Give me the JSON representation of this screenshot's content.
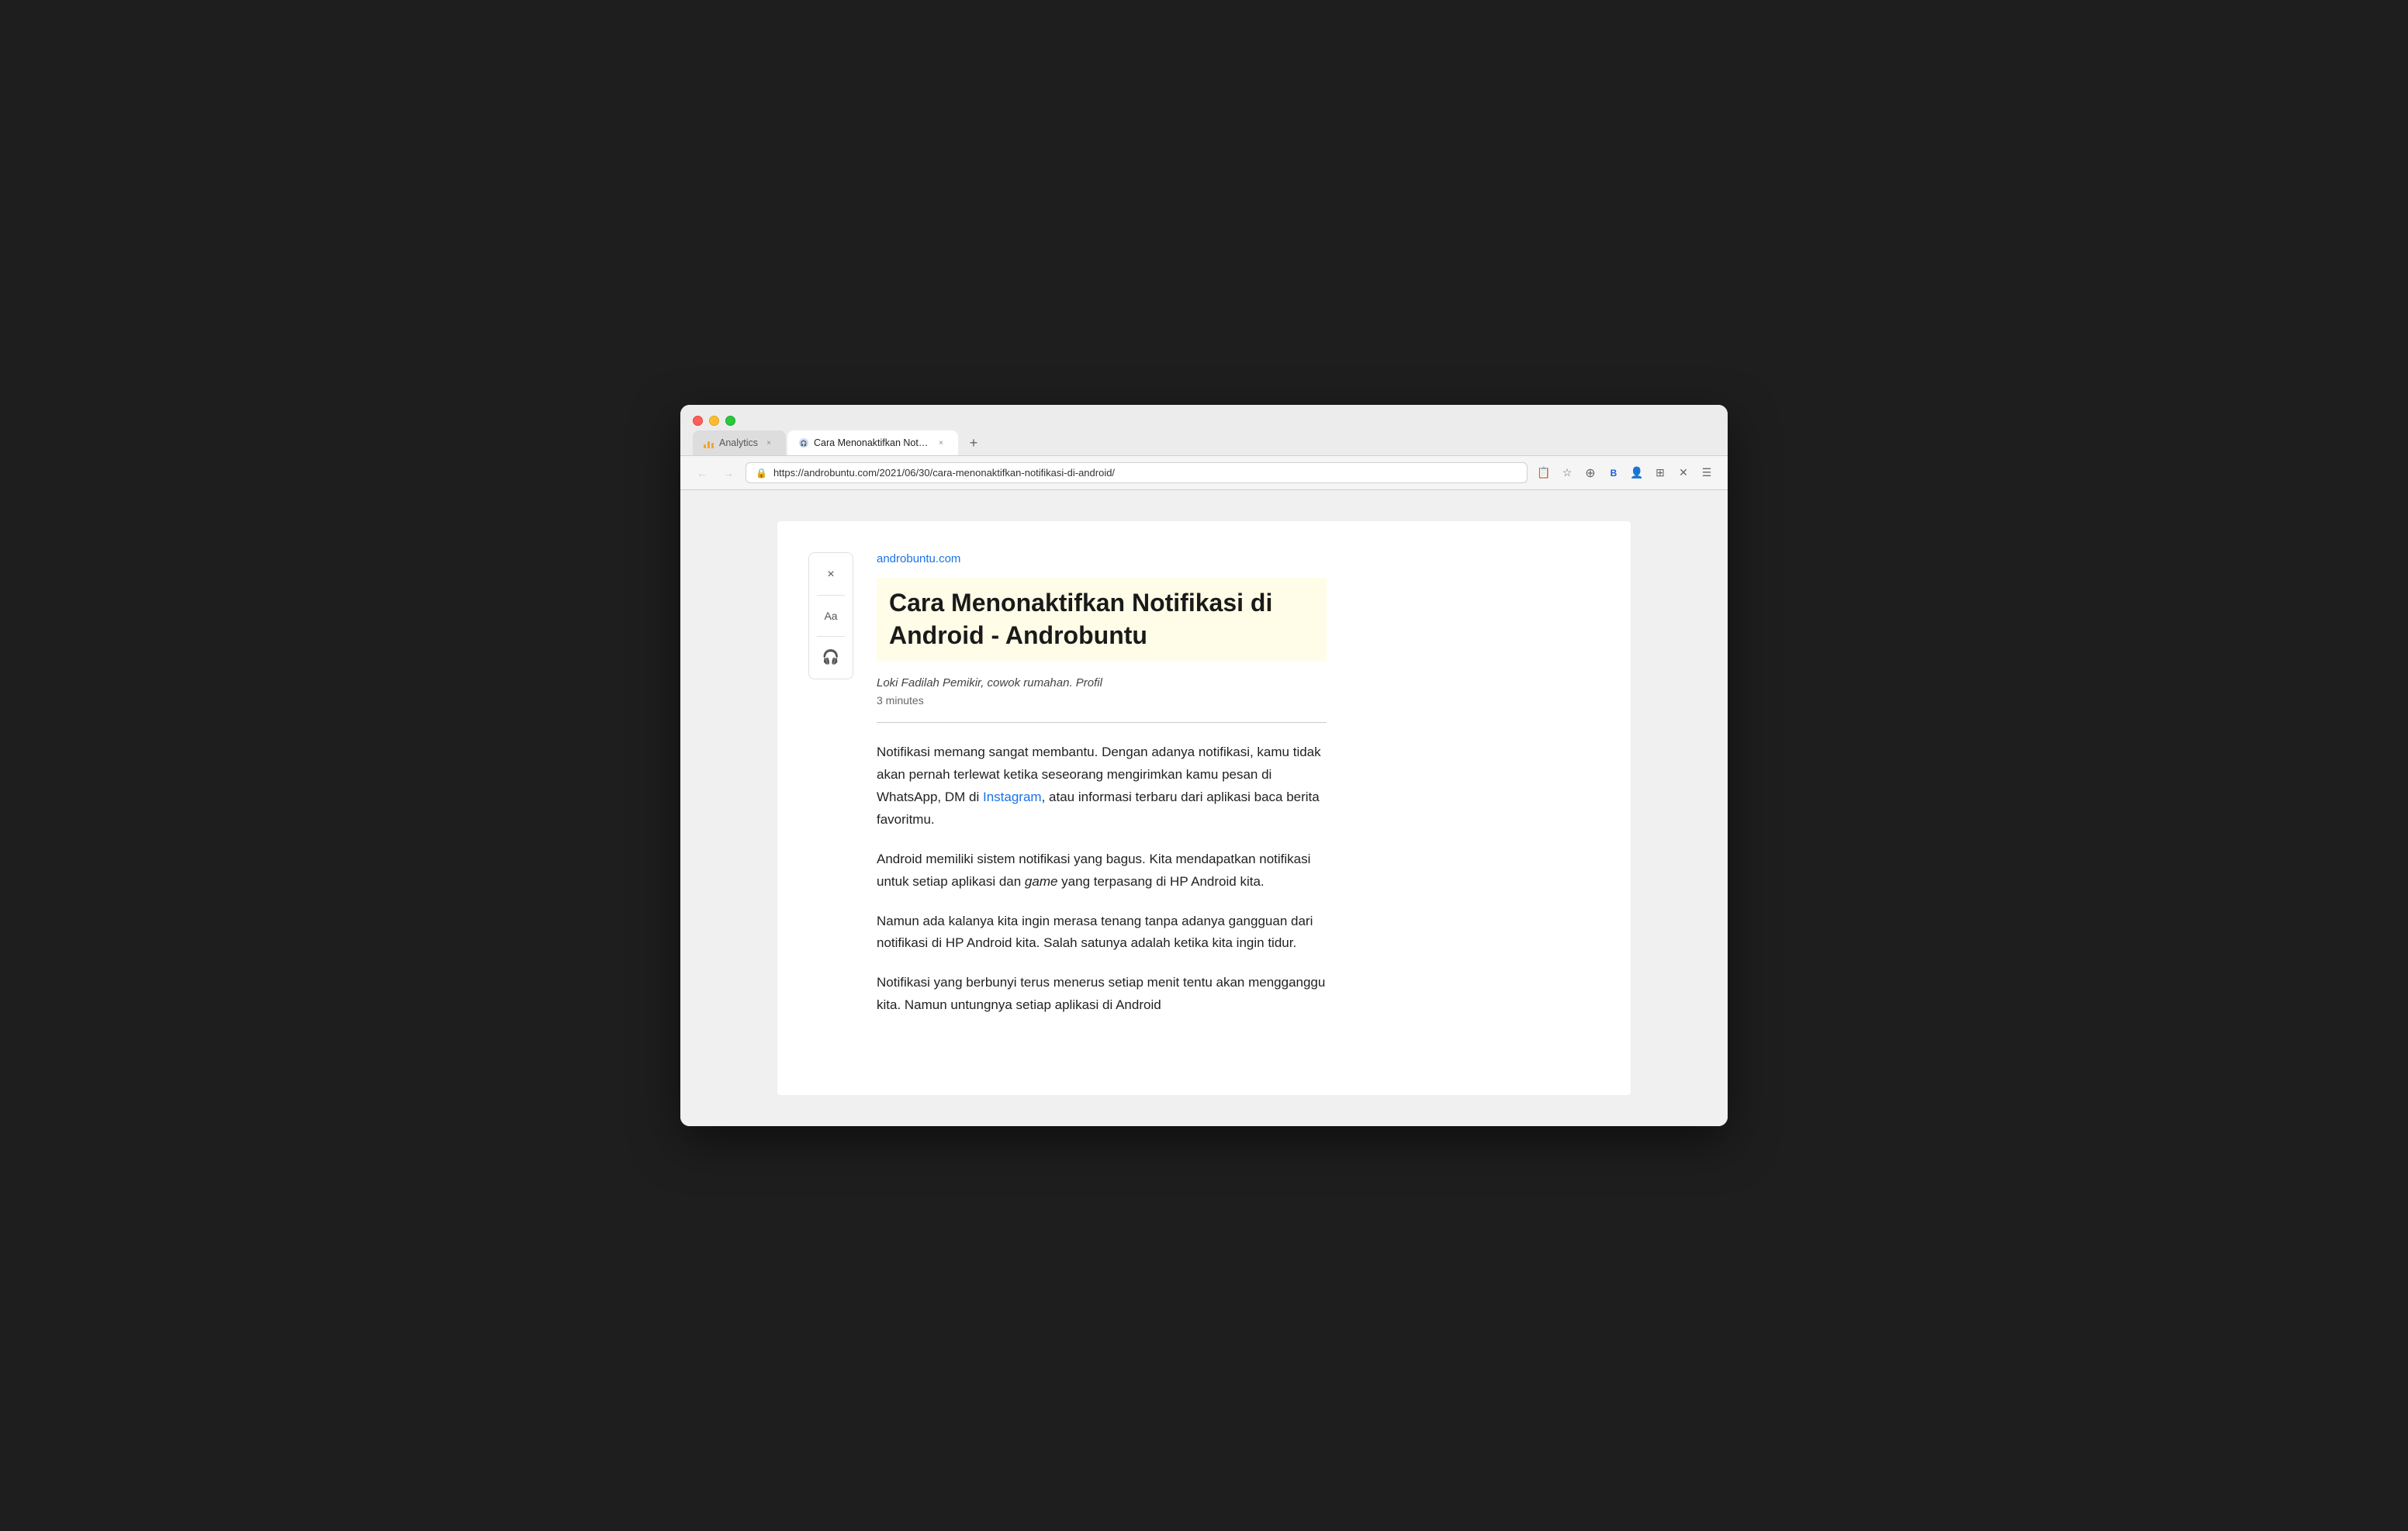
{
  "browser": {
    "tabs": [
      {
        "id": "tab-analytics",
        "label": "Analytics",
        "icon": "analytics-icon",
        "active": false,
        "closeable": true
      },
      {
        "id": "tab-article",
        "label": "Cara Menonaktifkan Notifikasi c…",
        "icon": "article-icon",
        "active": true,
        "closeable": true
      }
    ],
    "new_tab_button": "+",
    "url": "https://androbuntu.com/2021/06/30/cara-menonaktifkan-notifikasi-di-android/"
  },
  "toolbar": {
    "back_disabled": true,
    "forward_disabled": true,
    "icons": [
      "📋",
      "☆",
      "⊕",
      "🔒",
      "👤",
      "⊞",
      "✕",
      "☰"
    ]
  },
  "reader": {
    "tools": {
      "close_label": "×",
      "font_label": "Aa",
      "listen_label": "🎧"
    },
    "article": {
      "site_url": "androbuntu.com",
      "title": "Cara Menonaktifkan Notifikasi di Android - Androbuntu",
      "author": "Loki Fadilah Pemikir, cowok rumahan. Profil",
      "read_time": "3 minutes",
      "paragraphs": [
        {
          "id": "p1",
          "text_before": "Notifikasi memang sangat membantu. Dengan adanya notifikasi, kamu tidak akan pernah terlewat ketika seseorang mengirimkan kamu pesan di WhatsApp, DM di ",
          "link_text": "Instagram",
          "link_href": "#",
          "text_after": ", atau informasi terbaru dari aplikasi baca berita favoritmu."
        },
        {
          "id": "p2",
          "text": "Android memiliki sistem notifikasi yang bagus. Kita mendapatkan notifikasi untuk setiap aplikasi dan ",
          "italic": "game",
          "text_after": " yang terpasang di HP Android kita."
        },
        {
          "id": "p3",
          "text": "Namun ada kalanya kita ingin merasa tenang tanpa adanya gangguan dari notifikasi di HP Android kita. Salah satunya adalah ketika kita ingin tidur."
        },
        {
          "id": "p4",
          "text": "Notifikasi yang berbunyi terus menerus setiap menit tentu akan mengganggu kita. Namun untungnya setiap aplikasi di Android"
        }
      ]
    }
  }
}
